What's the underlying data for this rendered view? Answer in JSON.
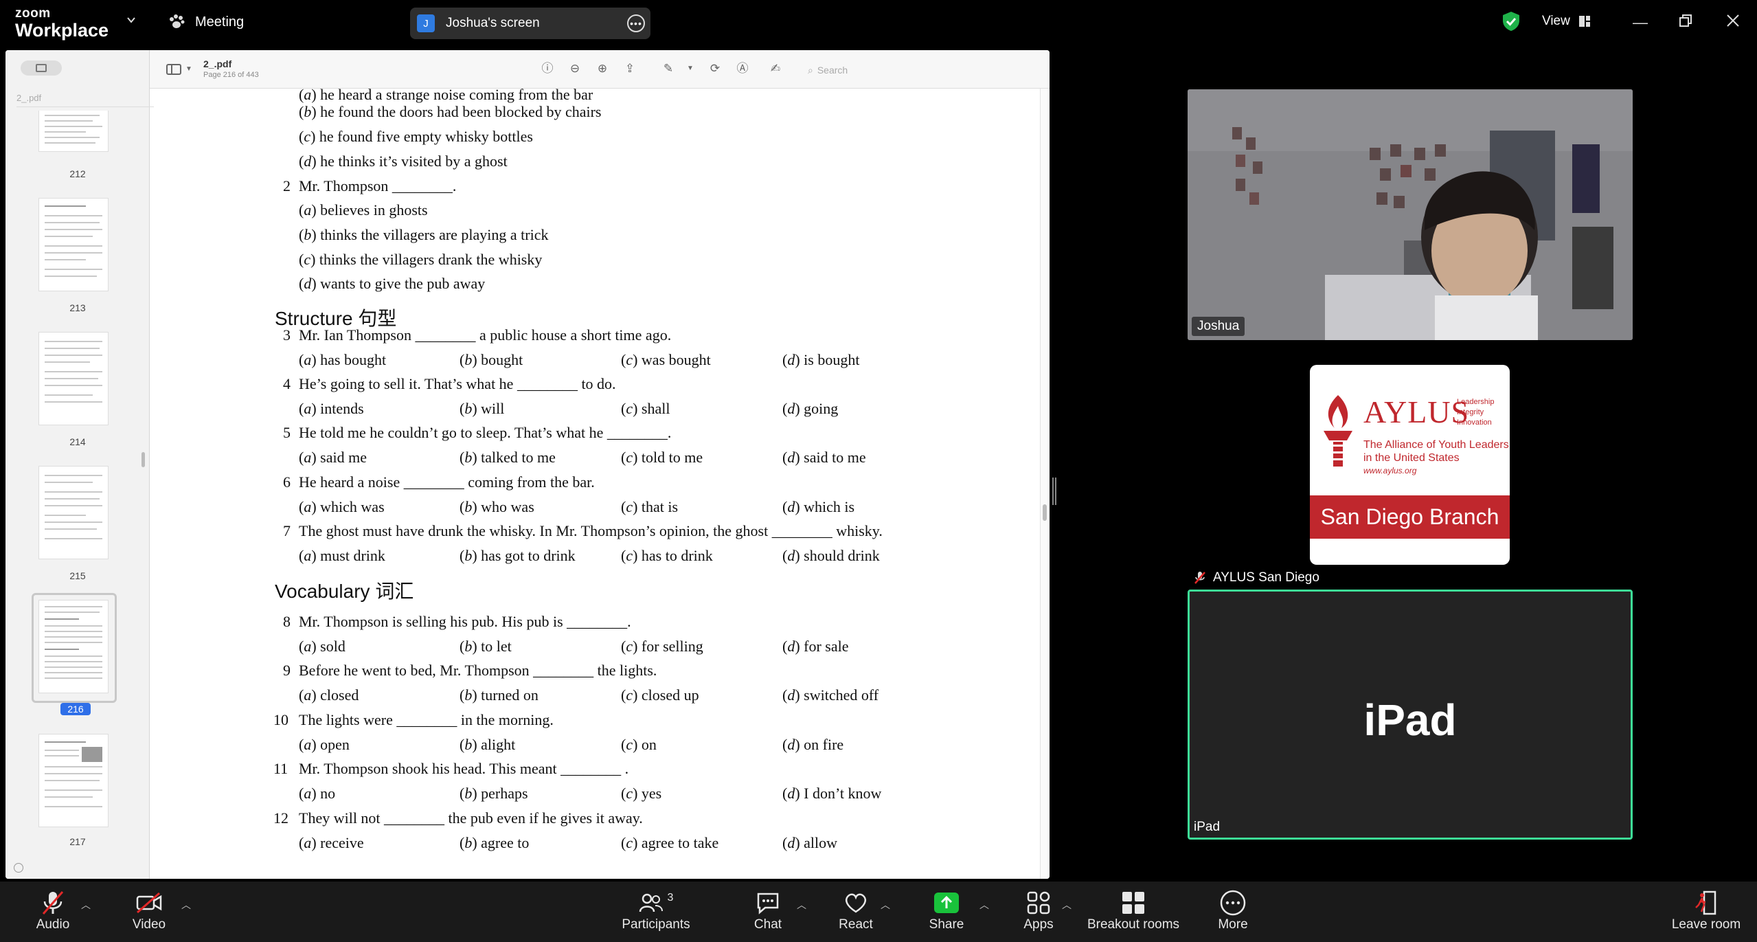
{
  "app": {
    "logo_line1": "zoom",
    "logo_line2": "Workplace",
    "meeting_label": "Meeting",
    "share_avatar": "J",
    "share_title": "Joshua's screen",
    "view_label": "View"
  },
  "pdf": {
    "filename": "2_.pdf",
    "page_info": "Page 216 of 443",
    "search_placeholder": "Search",
    "sidebar_title": "2_.pdf",
    "thumbnails": [
      {
        "label": "212",
        "selected": false
      },
      {
        "label": "213",
        "selected": false
      },
      {
        "label": "214",
        "selected": false
      },
      {
        "label": "215",
        "selected": false
      },
      {
        "label": "216",
        "selected": true
      },
      {
        "label": "217",
        "selected": false
      }
    ],
    "lines": {
      "a1": "he heard a strange noise coming from the bar",
      "b1": "he found the doors had been blocked by chairs",
      "c1": "he found five empty whisky bottles",
      "d1": "he thinks it’s visited by a ghost",
      "q2": "Mr. Thompson ________.",
      "a2": "believes in ghosts",
      "b2": "thinks the villagers are playing a trick",
      "c2": "thinks the villagers drank the whisky",
      "d2": "wants to give the pub away",
      "structure": "Structure 句型",
      "q3": "Mr. Ian Thompson ________ a public house a short time ago.",
      "q3o": [
        "has bought",
        "bought",
        "was bought",
        "is bought"
      ],
      "q4": "He’s going to sell it. That’s what he ________ to do.",
      "q4o": [
        "intends",
        "will",
        "shall",
        "going"
      ],
      "q5": "He told me he couldn’t go to sleep. That’s what he ________.",
      "q5o": [
        "said me",
        "talked to me",
        "told to me",
        "said to me"
      ],
      "q6": "He heard a noise ________ coming from the bar.",
      "q6o": [
        "which was",
        "who was",
        "that is",
        "which is"
      ],
      "q7": "The ghost must have drunk the whisky. In Mr. Thompson’s opinion, the ghost ________ whisky.",
      "q7o": [
        "must drink",
        "has got to drink",
        "has to drink",
        "should drink"
      ],
      "vocabulary": "Vocabulary 词汇",
      "q8": "Mr. Thompson is selling his pub. His pub is ________.",
      "q8o": [
        "sold",
        "to let",
        "for selling",
        "for sale"
      ],
      "q9": "Before he went to bed, Mr. Thompson ________ the lights.",
      "q9o": [
        "closed",
        "turned on",
        "closed up",
        "switched off"
      ],
      "q10": "The lights were ________ in the morning.",
      "q10o": [
        "open",
        "alight",
        "on",
        "on fire"
      ],
      "q11": "Mr. Thompson shook his head. This meant ________ .",
      "q11o": [
        "no",
        "perhaps",
        "yes",
        "I don’t know"
      ],
      "q12": "They will not ________ the pub even if he gives it away.",
      "q12o": [
        "receive",
        "agree to",
        "agree to take",
        "allow"
      ]
    },
    "numbers": [
      "2",
      "3",
      "4",
      "5",
      "6",
      "7",
      "8",
      "9",
      "10",
      "11",
      "12"
    ],
    "letters": [
      "a",
      "b",
      "c",
      "d"
    ]
  },
  "participants": [
    {
      "name": "Joshua"
    },
    {
      "name": "AYLUS San Diego",
      "muted": true
    },
    {
      "name": "iPad",
      "display": "iPad",
      "active_speaker": true
    }
  ],
  "aylus_logo": {
    "big": "AYLUS",
    "side": [
      "Leadership",
      "Integrity",
      "Innovation"
    ],
    "sub1": "The Alliance of Youth Leaders",
    "sub2": "in the United States",
    "url": "www.aylus.org",
    "band": "San Diego Branch"
  },
  "toolbar": {
    "audio": "Audio",
    "video": "Video",
    "participants": "Participants",
    "participants_count": "3",
    "chat": "Chat",
    "react": "React",
    "share": "Share",
    "apps": "Apps",
    "breakout": "Breakout rooms",
    "more": "More",
    "leave": "Leave room"
  },
  "colors": {
    "share_green": "#19c23b",
    "speaker_border": "#3ddc97",
    "aylus_red": "#c0272d",
    "muted_red": "#e02828",
    "page_badge": "#2f6fe8"
  }
}
